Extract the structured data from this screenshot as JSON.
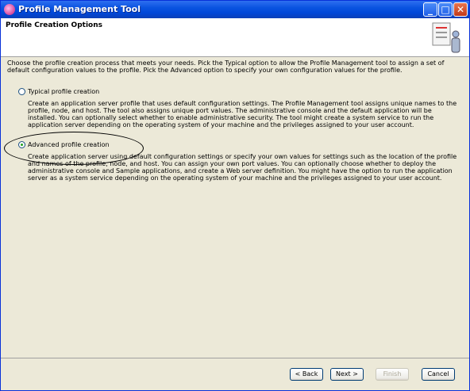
{
  "window": {
    "title": "Profile Management Tool"
  },
  "titlebar_buttons": [
    "_",
    "□",
    "✕"
  ],
  "header": {
    "title": "Profile Creation Options"
  },
  "intro": "Choose the profile creation process that meets your needs. Pick the Typical option to allow the Profile Management tool to assign a set of default configuration values to the profile. Pick the Advanced option to specify your own configuration values for the profile.",
  "options": {
    "typical": {
      "label": "Typical profile creation",
      "selected": false,
      "description": "Create an application server profile that uses default configuration settings. The Profile Management tool assigns unique names to the profile, node, and host. The tool also assigns unique port values. The administrative console and the default application will be installed. You can optionally select whether to enable administrative security. The tool might create a system service to run the application server depending on the operating system of your machine and the privileges assigned to your user account."
    },
    "advanced": {
      "label": "Advanced profile creation",
      "selected": true,
      "description": "Create application server using default configuration settings or specify your own values for settings such as the location of the profile and names of the profile, node, and host. You can assign your own port values. You can optionally choose whether to deploy the administrative console and Sample applications, and create a Web server definition. You might have the option to run the application server as a system service depending on the operating system of your machine and the privileges assigned to your user account."
    }
  },
  "buttons": {
    "back": "< Back",
    "next": "Next >",
    "finish": "Finish",
    "cancel": "Cancel"
  },
  "colors": {
    "titlebar": "#0a53e0",
    "selected_radio": "#21a121"
  }
}
